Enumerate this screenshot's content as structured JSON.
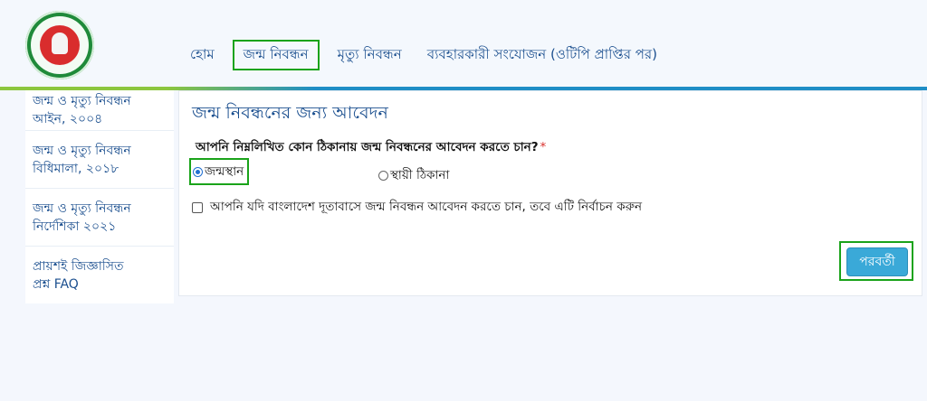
{
  "header": {
    "logo_icon": "government-emblem-icon",
    "nav": [
      {
        "label": "হোম",
        "active": false
      },
      {
        "label": "জন্ম নিবন্ধন",
        "active": true
      },
      {
        "label": "মৃত্যু নিবন্ধন",
        "active": false
      },
      {
        "label": "ব্যবহারকারী সংযোজন (ওটিপি প্রাপ্তির পর)",
        "active": false
      }
    ]
  },
  "sidebar": {
    "items": [
      {
        "line1": "জন্ম ও মৃত্যু নিবন্ধন",
        "line2": "আইন, ২০০৪"
      },
      {
        "line1": "জন্ম ও মৃত্যু নিবন্ধন",
        "line2": "বিধিমালা, ২০১৮"
      },
      {
        "line1": "জন্ম ও মৃত্যু নিবন্ধন",
        "line2": "নির্দেশিকা ২০২১"
      },
      {
        "line1": "প্রায়শই জিজ্ঞাসিত",
        "line2": "প্রশ্ন FAQ"
      }
    ]
  },
  "form": {
    "title": "জন্ম নিবন্ধনের জন্য আবেদন",
    "question": "আপনি নিম্নলিখিত কোন ঠিকানায় জন্ম নিবন্ধনের আবেদন করতে চান?",
    "required_mark": "*",
    "options": [
      {
        "label": "জন্মস্থান",
        "selected": true
      },
      {
        "label": "স্থায়ী ঠিকানা",
        "selected": false
      }
    ],
    "embassy_checkbox_label": "আপনি যদি বাংলাদেশ দূতাবাসে জন্ম নিবন্ধন আবেদন করতে চান, তবে এটি নির্বাচন করুন",
    "embassy_checked": false,
    "next_label": "পরবর্তী"
  },
  "colors": {
    "accent_blue": "#1b4f8f",
    "button_blue": "#3aa9d8",
    "highlight_green": "#1aa31a",
    "stripe_green": "#8cc63e"
  }
}
